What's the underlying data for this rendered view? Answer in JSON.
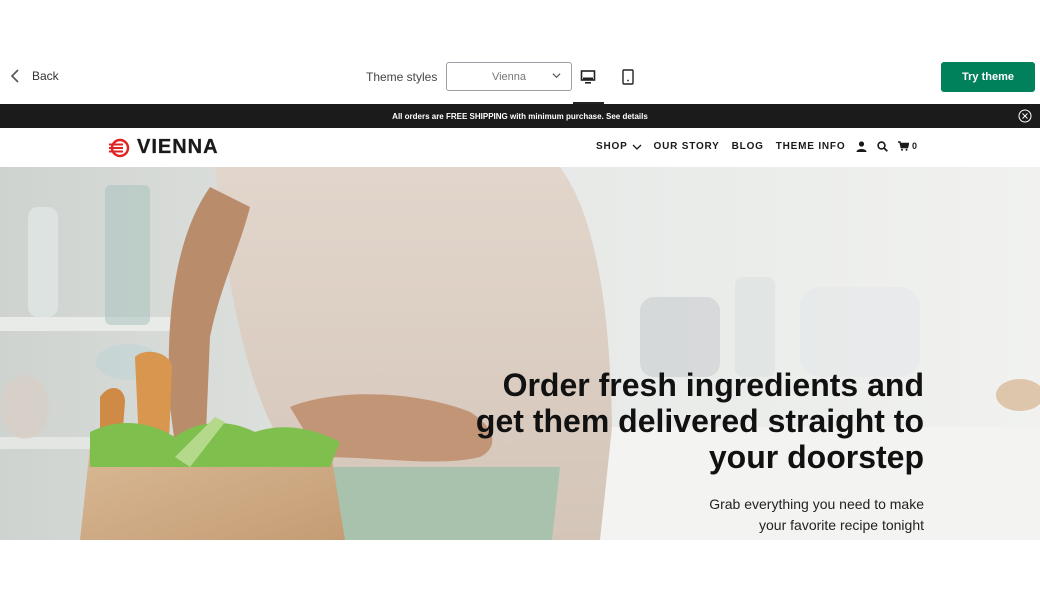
{
  "toolbar": {
    "back_label": "Back",
    "theme_styles_label": "Theme styles",
    "theme_select_value": "Vienna",
    "try_theme_label": "Try theme"
  },
  "announcement": {
    "text": "All orders are FREE SHIPPING with minimum purchase. See details"
  },
  "header": {
    "logo_text": "VIENNA",
    "nav": [
      "SHOP",
      "OUR STORY",
      "BLOG",
      "THEME INFO"
    ],
    "cart_count": "0"
  },
  "hero": {
    "headline_lines": [
      "Order fresh ingredients and",
      "get them delivered straight to",
      "your doorstep"
    ],
    "sub_lines": [
      "Grab everything you need to make",
      "your favorite recipe tonight"
    ]
  },
  "colors": {
    "accent": "#00805b",
    "announcement_bg": "#1b1b1b",
    "logo_red": "#e02424"
  },
  "icons": {
    "back": "chevron-left-icon",
    "select_caret": "chevron-down-icon",
    "desktop": "desktop-icon",
    "tablet": "tablet-icon",
    "close": "close-circle-icon",
    "account": "user-icon",
    "search": "search-icon",
    "cart": "cart-icon"
  }
}
